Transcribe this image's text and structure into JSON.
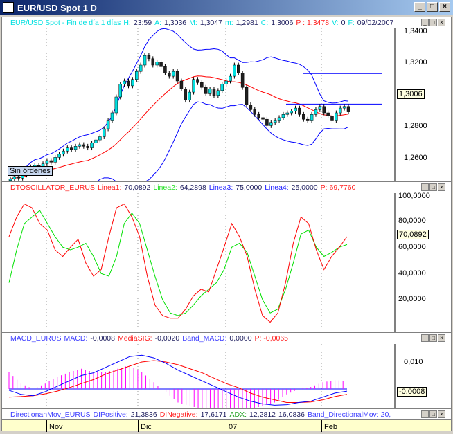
{
  "window": {
    "title": "EUR/USD Spot 1 D",
    "buttons": [
      "_",
      "□",
      "×"
    ]
  },
  "price_pane": {
    "header": [
      {
        "text": "EUR/USD Spot - Fin de día 1 días",
        "color": "#00e0e0"
      },
      {
        "text": "H:",
        "color": "#00e0e0"
      },
      {
        "text": "23:59",
        "color": "#202060"
      },
      {
        "text": "A:",
        "color": "#00e0e0"
      },
      {
        "text": "1,3036",
        "color": "#202060"
      },
      {
        "text": "M:",
        "color": "#00e0e0"
      },
      {
        "text": "1,3047",
        "color": "#202060"
      },
      {
        "text": "m:",
        "color": "#00e0e0"
      },
      {
        "text": "1,2981",
        "color": "#202060"
      },
      {
        "text": "C:",
        "color": "#00e0e0"
      },
      {
        "text": "1,3006",
        "color": "#202060"
      },
      {
        "text": "P : 1,3478",
        "color": "#ff2020"
      },
      {
        "text": "V:",
        "color": "#00e0e0"
      },
      {
        "text": "0",
        "color": "#202060"
      },
      {
        "text": "F:",
        "color": "#00e0e0"
      },
      {
        "text": "09/02/2007",
        "color": "#202060"
      }
    ],
    "y_ticks": [
      "1,3400",
      "1,3200",
      "1,2800",
      "1,2600"
    ],
    "current_value": "1,3006",
    "orders_label": "Sin órdenes",
    "closes": [
      1.2585,
      1.26,
      1.259,
      1.261,
      1.264,
      1.266,
      1.267,
      1.266,
      1.268,
      1.27,
      1.269,
      1.272,
      1.274,
      1.276,
      1.278,
      1.277,
      1.279,
      1.28,
      1.279,
      1.278,
      1.281,
      1.283,
      1.285,
      1.29,
      1.295,
      1.3,
      1.31,
      1.318,
      1.32,
      1.317,
      1.321,
      1.326,
      1.33,
      1.336,
      1.334,
      1.33,
      1.332,
      1.329,
      1.325,
      1.323,
      1.326,
      1.32,
      1.315,
      1.308,
      1.313,
      1.321,
      1.319,
      1.316,
      1.312,
      1.315,
      1.311,
      1.314,
      1.318,
      1.32,
      1.323,
      1.33,
      1.325,
      1.316,
      1.305,
      1.302,
      1.299,
      1.297,
      1.296,
      1.292,
      1.294,
      1.295,
      1.297,
      1.299,
      1.3,
      1.301,
      1.303,
      1.299,
      1.296,
      1.295,
      1.299,
      1.302,
      1.304,
      1.3,
      1.298,
      1.295,
      1.3,
      1.303,
      1.304,
      1.3006
    ]
  },
  "oscillator_pane": {
    "header": [
      {
        "text": "DTOSCILLATOR_EURUS",
        "color": "#ff2020"
      },
      {
        "text": "Linea1:",
        "color": "#ff2020"
      },
      {
        "text": "70,0892",
        "color": "#202060"
      },
      {
        "text": "Linea2:",
        "color": "#20e020"
      },
      {
        "text": "64,2898",
        "color": "#202060"
      },
      {
        "text": "Linea3:",
        "color": "#2020ff"
      },
      {
        "text": "75,0000",
        "color": "#202060"
      },
      {
        "text": "Linea4:",
        "color": "#2020ff"
      },
      {
        "text": "25,0000",
        "color": "#202060"
      },
      {
        "text": "P: 69,7760",
        "color": "#ff2020"
      }
    ],
    "y_ticks": [
      "100,0000",
      "80,0000",
      "60,0000",
      "40,0000",
      "20,0000"
    ],
    "current_value": "70,0892",
    "levels": [
      75,
      25
    ],
    "line1": [
      70,
      85,
      95,
      92,
      80,
      75,
      60,
      55,
      62,
      68,
      50,
      40,
      45,
      70,
      92,
      95,
      85,
      70,
      40,
      18,
      10,
      8,
      8,
      15,
      25,
      30,
      28,
      45,
      62,
      80,
      70,
      55,
      30,
      10,
      5,
      12,
      35,
      65,
      85,
      80,
      60,
      45,
      55,
      62,
      70
    ],
    "line2": [
      35,
      60,
      80,
      85,
      90,
      80,
      70,
      62,
      60,
      62,
      65,
      55,
      42,
      40,
      55,
      80,
      88,
      80,
      60,
      40,
      22,
      12,
      10,
      12,
      18,
      25,
      30,
      35,
      45,
      62,
      65,
      58,
      40,
      22,
      12,
      15,
      30,
      50,
      72,
      75,
      62,
      55,
      58,
      62,
      64
    ]
  },
  "macd_pane": {
    "header": [
      {
        "text": "MACD_EURUS",
        "color": "#4040ff"
      },
      {
        "text": "MACD:",
        "color": "#4040ff"
      },
      {
        "text": "-0,0008",
        "color": "#202060"
      },
      {
        "text": "MediaSIG:",
        "color": "#ff2020"
      },
      {
        "text": "-0,0020",
        "color": "#202060"
      },
      {
        "text": "Band_MACD:",
        "color": "#4040ff"
      },
      {
        "text": "0,0000",
        "color": "#202060"
      },
      {
        "text": "P: -0,0065",
        "color": "#ff2020"
      }
    ],
    "y_ticks": [
      "0,010"
    ],
    "current_value": "-0,0008",
    "macd": [
      -0.0005,
      -0.002,
      -0.0025,
      -0.001,
      0.001,
      0.003,
      0.005,
      0.006,
      0.008,
      0.01,
      0.012,
      0.0125,
      0.0115,
      0.0095,
      0.007,
      0.005,
      0.003,
      0.001,
      -0.001,
      -0.003,
      -0.0045,
      -0.0055,
      -0.006,
      -0.0058,
      -0.005,
      -0.0045,
      -0.003,
      -0.0015,
      -0.0008
    ],
    "signal": [
      -0.003,
      -0.0028,
      -0.0025,
      -0.0018,
      -0.0008,
      0.0005,
      0.002,
      0.0035,
      0.0055,
      0.007,
      0.0085,
      0.01,
      0.0105,
      0.01,
      0.009,
      0.0075,
      0.006,
      0.004,
      0.002,
      0.0005,
      -0.0015,
      -0.003,
      -0.004,
      -0.005,
      -0.005,
      -0.0048,
      -0.004,
      -0.0028,
      -0.002
    ]
  },
  "dm_pane": {
    "header": [
      {
        "text": "DirectionanMov_EURUS",
        "color": "#4040ff"
      },
      {
        "text": "DIPositive:",
        "color": "#4040ff"
      },
      {
        "text": "21,3836",
        "color": "#202060"
      },
      {
        "text": "DINegative:",
        "color": "#ff2020"
      },
      {
        "text": "17,6171",
        "color": "#202060"
      },
      {
        "text": "ADX:",
        "color": "#20a020"
      },
      {
        "text": "12,2812",
        "color": "#202060"
      },
      {
        "text": "16,0836",
        "color": "#202060"
      },
      {
        "text": "Band_DirectionalMov: 20,",
        "color": "#4040ff"
      }
    ]
  },
  "x_axis": {
    "labels": [
      "Nov",
      "Dic",
      "07",
      "Feb"
    ]
  }
}
